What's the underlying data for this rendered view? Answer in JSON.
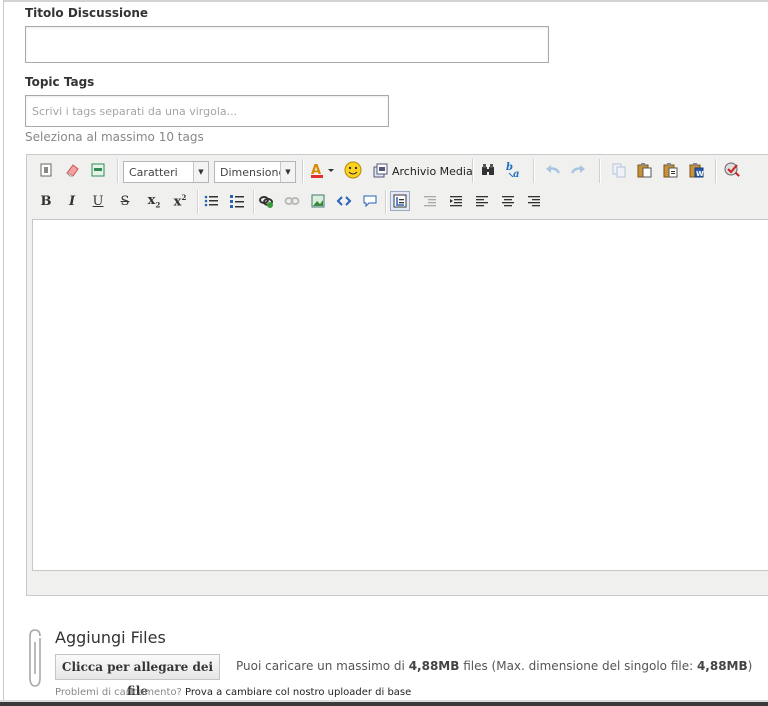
{
  "form": {
    "title_label": "Titolo Discussione",
    "title_value": "",
    "tags_label": "Topic Tags",
    "tags_placeholder": "Scrivi i tags separati da una virgola...",
    "tags_hint": "Seleziona al massimo 10 tags"
  },
  "editor": {
    "font_dropdown": "Caratteri",
    "size_dropdown": "Dimensione",
    "media_label": "Archivio Media",
    "row1_icons": [
      "source-icon",
      "eraser-icon",
      "template-icon",
      "font-color-icon",
      "smiley-icon",
      "media-icon",
      "find-icon",
      "replace-icon",
      "undo-icon",
      "redo-icon",
      "copy-icon",
      "paste-icon",
      "paste-text-icon",
      "paste-word-icon",
      "spellcheck-icon"
    ],
    "row2_icons": [
      "bold-icon",
      "italic-icon",
      "underline-icon",
      "strikethrough-icon",
      "subscript-icon",
      "superscript-icon",
      "bullet-list-icon",
      "numbered-list-icon",
      "link-icon",
      "unlink-icon",
      "image-icon",
      "code-icon",
      "quote-icon",
      "indent-icon",
      "outdent-icon",
      "justify-icon",
      "align-left-icon",
      "align-center-icon",
      "align-right-icon"
    ],
    "labels": {
      "bold": "B",
      "italic": "I",
      "underline": "U",
      "strike": "S",
      "sub": "x",
      "sub_idx": "2",
      "sup": "x",
      "sup_idx": "2"
    }
  },
  "attach": {
    "title": "Aggiungi Files",
    "button_label": "Clicca per allegare dei file",
    "limit_prefix": "Puoi caricare un massimo di ",
    "limit_total": "4,88MB",
    "limit_middle": " files (Max. dimensione del singolo file: ",
    "limit_single": "4,88MB",
    "limit_suffix": ")",
    "problems_text": "Problemi di caricamento? ",
    "problems_link": "Prova a cambiare col nostro uploader di base"
  }
}
